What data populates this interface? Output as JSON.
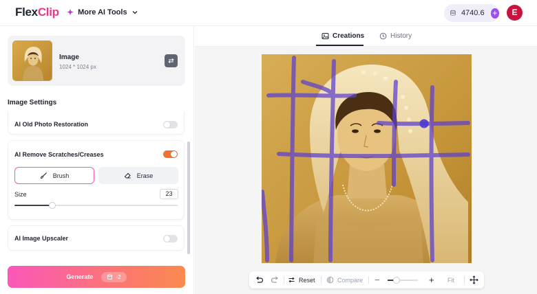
{
  "header": {
    "logo_main": "Flex",
    "logo_accent": "Clip",
    "more_tools_label": "More AI Tools",
    "credits_value": "4740.6",
    "avatar_initial": "E"
  },
  "sidebar": {
    "image_card": {
      "title": "Image",
      "dimensions": "1024 * 1024 px"
    },
    "section_title": "Image Settings",
    "settings": {
      "restoration": {
        "label": "AI Old Photo Restoration",
        "enabled": false
      },
      "scratches": {
        "label": "AI Remove Scratches/Creases",
        "enabled": true,
        "brush_label": "Brush",
        "erase_label": "Erase",
        "size_label": "Size",
        "size_value": "23",
        "size_fraction": 0.23
      },
      "upscaler": {
        "label": "AI Image Upscaler",
        "enabled": false
      }
    },
    "generate": {
      "label": "Generate",
      "cost": "-2"
    }
  },
  "main": {
    "tabs": [
      {
        "label": "Creations",
        "active": true,
        "icon": "image-icon"
      },
      {
        "label": "History",
        "active": false,
        "icon": "clock-icon"
      }
    ],
    "toolbar": {
      "reset_label": "Reset",
      "compare_label": "Compare",
      "fit_label": "Fit",
      "zoom_fraction": 0.3
    }
  },
  "colors": {
    "accent_orange": "#f07233",
    "accent_pink": "#f05aa6",
    "brush_stroke": "#5a3fcf",
    "avatar_bg": "#c8133f",
    "credits_plus": "#9c4ff0"
  }
}
